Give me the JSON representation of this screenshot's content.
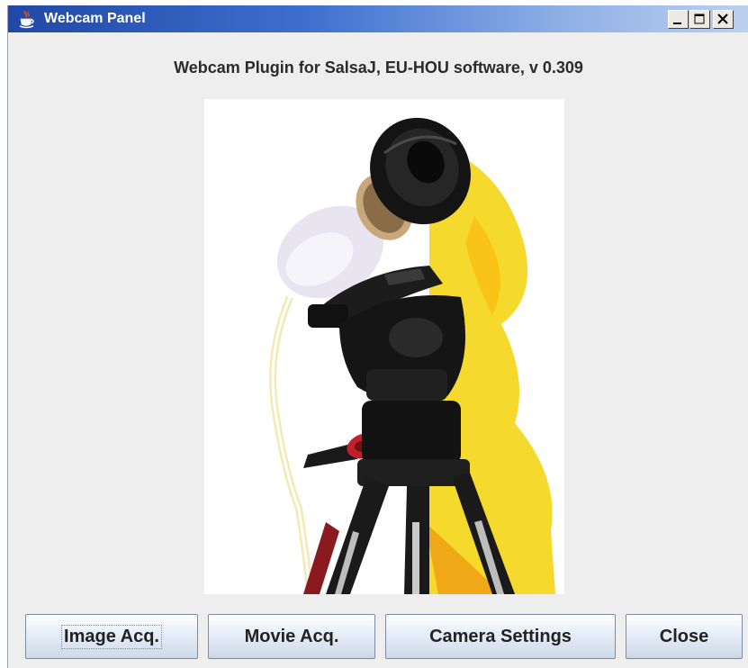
{
  "window": {
    "title": "Webcam Panel",
    "icon": "java-cup-icon",
    "controls": [
      "minimize-icon",
      "maximize-icon",
      "close-icon"
    ]
  },
  "header": {
    "text": "Webcam Plugin for SalsaJ, EU-HOU software, v 0.309"
  },
  "photo": {
    "subject": "webcam mounted on tripod"
  },
  "buttons": {
    "image_acq": "Image Acq.",
    "movie_acq": "Movie Acq.",
    "camera_settings": "Camera Settings",
    "close": "Close"
  },
  "colors": {
    "titlebar_start": "#2148a6",
    "titlebar_end": "#bcd0ee",
    "panel_background": "#eeeeee",
    "shadow_yellow": "#f5d92c"
  }
}
